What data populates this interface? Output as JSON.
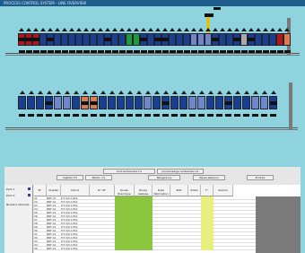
{
  "window": {
    "title": "PROCESS CONTROL SYSTEM - LINE OVERVIEW"
  },
  "colors": {
    "background": "#8fd3de",
    "title_bar": "#1e5c8c",
    "tank_red": "#b01818",
    "tank_blue": "#1a3f8f",
    "tank_lightblue": "#6f86c8",
    "tank_green": "#1e9a3a",
    "tank_grey": "#a8a8a8",
    "tank_orange": "#e07a4a",
    "highlight_green": "#8cc63f",
    "highlight_yellow": "#e8ef7c"
  },
  "icons": {
    "crane": "yellow-crane-hook-icon",
    "process_tank": "tank-icon"
  },
  "toolbar": {
    "row1": [
      "Andi ambientes C1",
      "Condensarge ambientes C1"
    ],
    "row2": [
      "Injektor P1",
      "Mazin. C1",
      "Rengeduvs",
      "Reval abemos",
      "Printed"
    ]
  },
  "left_panel": {
    "items": [
      "Pont 1",
      "Pont 2",
      "Niveaux Alarmes"
    ]
  },
  "table": {
    "headers": [
      "N°",
      "Qualité",
      "Article",
      "N° OF",
      "Durée théorique",
      "Durée réalisée",
      "Date fabrication",
      "Etat",
      "Poste",
      "T°",
      "Alarme"
    ],
    "rows": [
      [
        "21",
        "BRT-01",
        "DT-3/0-1052",
        "",
        "",
        "",
        "",
        "",
        "",
        "",
        ""
      ],
      [
        "22",
        "BRT-01",
        "DT-3/0-1052",
        "",
        "",
        "",
        "",
        "",
        "",
        "",
        ""
      ],
      [
        "23",
        "BRT-01",
        "DT-3/0-1052",
        "",
        "",
        "",
        "",
        "",
        "",
        "",
        ""
      ],
      [
        "24",
        "BRT-01",
        "DT-3/0-1052",
        "",
        "",
        "",
        "",
        "",
        "",
        "",
        ""
      ],
      [
        "25",
        "BRT-01",
        "DT-3/0-1052",
        "",
        "",
        "",
        "",
        "",
        "",
        "",
        ""
      ],
      [
        "26",
        "BRT-01",
        "DT-3/0-1052",
        "",
        "",
        "",
        "",
        "",
        "",
        "",
        ""
      ],
      [
        "27",
        "BRT-01",
        "DT-3/0-1052",
        "",
        "",
        "",
        "",
        "",
        "",
        "",
        ""
      ],
      [
        "28",
        "BRT-01",
        "DT-3/0-1052",
        "",
        "",
        "",
        "",
        "",
        "",
        "",
        ""
      ],
      [
        "29",
        "BRT-01",
        "DT-3/0-1052",
        "",
        "",
        "",
        "",
        "",
        "",
        "",
        ""
      ],
      [
        "30",
        "BRT-01",
        "DT-3/0-1052",
        "",
        "",
        "",
        "",
        "",
        "",
        "",
        ""
      ],
      [
        "31",
        "BRT-01",
        "DT-3/0-1052",
        "",
        "",
        "",
        "",
        "",
        "",
        "",
        ""
      ],
      [
        "32",
        "BRT-01",
        "DT-3/0-1052",
        "",
        "",
        "",
        "",
        "",
        "",
        "",
        ""
      ],
      [
        "33",
        "BRT-01",
        "DT-3/0-1052",
        "",
        "",
        "",
        "",
        "",
        "",
        "",
        ""
      ],
      [
        "34",
        "BRT-01",
        "DT-3/0-1052",
        "",
        "",
        "",
        "",
        "",
        "",
        "",
        ""
      ],
      [
        "35",
        "BRT-01",
        "DT-3/0-1052",
        "",
        "",
        "",
        "",
        "",
        "",
        "",
        ""
      ]
    ]
  }
}
